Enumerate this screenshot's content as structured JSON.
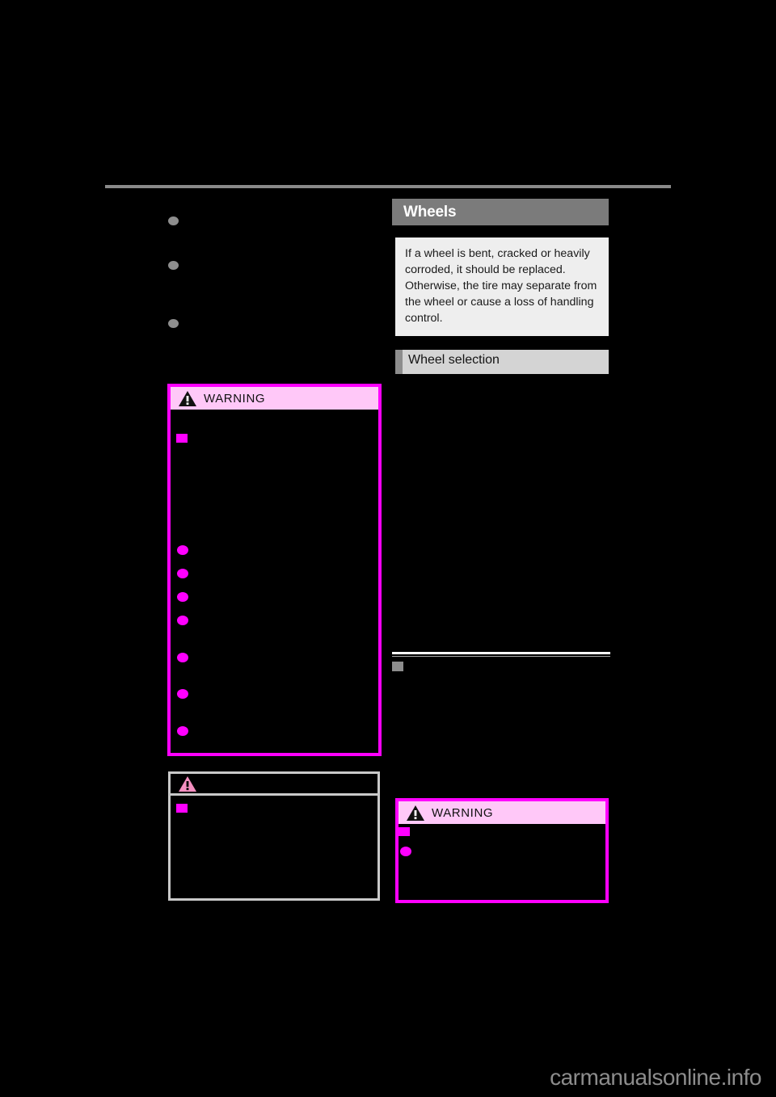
{
  "document": {
    "type": "vehicle-owners-manual-page",
    "watermark": "carmanualsonline.info"
  },
  "left_column": {
    "bullets": [
      {
        "marker": "gray-dot",
        "text": ""
      },
      {
        "marker": "gray-dot",
        "text": ""
      },
      {
        "marker": "gray-dot",
        "text": ""
      }
    ],
    "warning_box": {
      "label": "WARNING",
      "icon": "warning-triangle-icon",
      "border_color": "#ff00ff",
      "header_bg": "#ffc8f8",
      "subheads": [
        {
          "marker": "magenta-square",
          "text": ""
        }
      ],
      "bullets": [
        {
          "marker": "magenta-dot",
          "text": ""
        },
        {
          "marker": "magenta-dot",
          "text": ""
        },
        {
          "marker": "magenta-dot",
          "text": ""
        },
        {
          "marker": "magenta-dot",
          "text": ""
        },
        {
          "marker": "magenta-dot",
          "text": ""
        },
        {
          "marker": "magenta-dot",
          "text": ""
        },
        {
          "marker": "magenta-dot",
          "text": ""
        }
      ]
    },
    "notice_box": {
      "label": "",
      "icon": "notice-triangle-icon",
      "border_color": "#c9c9c9",
      "subheads": [
        {
          "marker": "magenta-square",
          "text": ""
        }
      ]
    }
  },
  "right_column": {
    "section_title": "Wheels",
    "section_title_bg": "#7b7b7b",
    "info_panel": {
      "bg": "#eeeeee",
      "text": "If a wheel is bent, cracked or heavily corroded, it should be replaced. Otherwise, the tire may separate from the wheel or cause a loss of handling control."
    },
    "subsection_title": "Wheel selection",
    "subsection_bg": "#d4d4d4",
    "body_paragraphs": [
      {
        "text": ""
      },
      {
        "text": ""
      }
    ],
    "rule_heading": {
      "marker": "gray-square",
      "text": ""
    },
    "warning_box": {
      "label": "WARNING",
      "icon": "warning-triangle-icon",
      "border_color": "#ff00ff",
      "header_bg": "#ffc8f8",
      "subheads": [
        {
          "marker": "magenta-square",
          "text": ""
        }
      ],
      "bullets": [
        {
          "marker": "magenta-dot",
          "text": ""
        }
      ]
    }
  }
}
